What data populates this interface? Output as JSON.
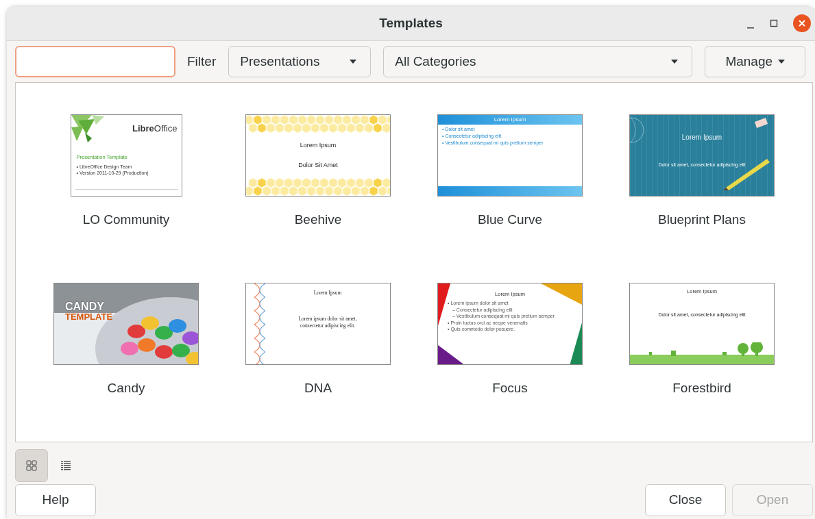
{
  "window": {
    "title": "Templates"
  },
  "search": {
    "focused": true
  },
  "filter_label": "Filter",
  "filters": [
    {
      "value": "Presentations"
    },
    {
      "value": "All Categories"
    }
  ],
  "manage_button": {
    "label": "Manage"
  },
  "templates": [
    {
      "name": "LO Community",
      "kind": "libreoffice",
      "selected": false,
      "logo": "**Libre**Office",
      "title": "Presentation Template",
      "lines": [
        {
          "text": "• LibreOffice Design Team"
        },
        {
          "text": "• Version 2011-10-29 (Production)"
        }
      ]
    },
    {
      "name": "Beehive",
      "kind": "beehive",
      "selected": false,
      "title": "Lorem Ipsum",
      "lines": [
        {
          "text": "Dolor Sit Amet"
        }
      ]
    },
    {
      "name": "Blue Curve",
      "kind": "bluecurve",
      "selected": false,
      "title": "Lorem Ipsum",
      "lines": [
        {
          "text": "• Dolor sit amet"
        },
        {
          "text": "• Consectetur adipiscing elit"
        },
        {
          "text": "• Vestibulum consequat mi quis pretium semper"
        }
      ]
    },
    {
      "name": "Blueprint Plans",
      "kind": "blueprint",
      "selected": false,
      "title": "Lorem Ipsum",
      "lines": [
        {
          "text": "Dolor sit amet, consectetur adipiscing elit"
        }
      ]
    },
    {
      "name": "Candy",
      "kind": "candy",
      "selected": false,
      "title": "CANDY",
      "subtitle": "TEMPLATE"
    },
    {
      "name": "DNA",
      "kind": "dna",
      "selected": false,
      "title": "Lorem Ipsum",
      "lines": [
        {
          "text": "Lorem ipsum dolor sit amet, consectetur adipiscing elit."
        }
      ]
    },
    {
      "name": "Focus",
      "kind": "focus",
      "selected": false,
      "title": "Lorem Ipsum",
      "lines": [
        {
          "text": "• Lorem ipsum dolor sit amet",
          "children": [
            {
              "text": "– Consectetur adipiscing elit"
            },
            {
              "text": "– Vestibulum consequat mi quis pretium semper"
            }
          ]
        },
        {
          "text": "• Proin luctus orci ac neque venenatis"
        },
        {
          "text": "• Quis commodo dolor posuere."
        }
      ]
    },
    {
      "name": "Forestbird",
      "kind": "forestbird",
      "selected": false,
      "title": "Lorem Ipsum",
      "lines": [
        {
          "text": "Dolor sit amet, consectetur adipiscing elit"
        }
      ]
    }
  ],
  "view_buttons": [
    {
      "kind": "thumbnails",
      "selected": true
    },
    {
      "kind": "list",
      "selected": false
    }
  ],
  "buttons": [
    {
      "label": "Help",
      "disabled": false
    },
    {
      "label": "Close",
      "disabled": false
    },
    {
      "label": "Open",
      "disabled": true
    }
  ]
}
